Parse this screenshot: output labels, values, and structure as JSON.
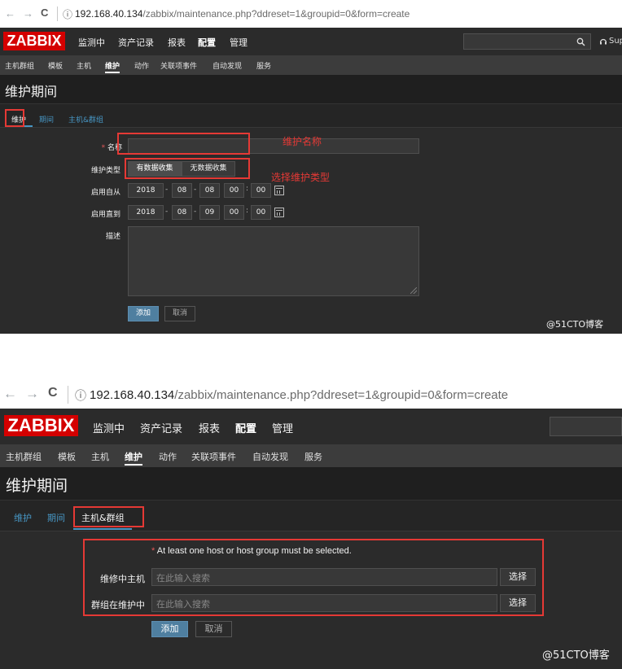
{
  "browser": {
    "url_host": "192.168.40.134",
    "url_path": "/zabbix/maintenance.php?ddreset=1&groupid=0&form=create",
    "nav_back": "←",
    "nav_forward": "→",
    "nav_reload": "C",
    "info_icon": "ⓘ"
  },
  "header": {
    "logo": "ZABBIX",
    "menu": [
      "监测中",
      "资产记录",
      "报表",
      "配置",
      "管理"
    ],
    "active_menu": "配置",
    "search_icon": "🔍",
    "support": "Sup",
    "support_icon": "headset-icon"
  },
  "submenu": [
    "主机群组",
    "模板",
    "主机",
    "维护",
    "动作",
    "关联项事件",
    "自动发现",
    "服务"
  ],
  "active_submenu": "维护",
  "page_title": "维护期间",
  "tabs": [
    "维护",
    "期间",
    "主机&群组"
  ],
  "form1": {
    "required_mark": "*",
    "name_label": "名称",
    "type_label": "维护类型",
    "type_options": [
      "有数据收集",
      "无数据收集"
    ],
    "active_from_label": "启用自从",
    "active_till_label": "启用直到",
    "active_from": {
      "year": "2018",
      "month": "08",
      "day": "08",
      "hour": "00",
      "minute": "00"
    },
    "active_till": {
      "year": "2018",
      "month": "08",
      "day": "09",
      "hour": "00",
      "minute": "00"
    },
    "date_dash": "-",
    "time_colon": ":",
    "description_label": "描述",
    "add_button": "添加",
    "cancel_button": "取消"
  },
  "annotations": {
    "name": "维护名称",
    "type": "选择维护类型"
  },
  "form2": {
    "warning": "At least one host or host group must be selected.",
    "hosts_label": "维修中主机",
    "groups_label": "群组在维护中",
    "placeholder": "在此输入搜索",
    "select_button": "选择",
    "add_button": "添加",
    "cancel_button": "取消"
  },
  "watermark": "@51CTO博客",
  "colors": {
    "brand_red": "#d40000",
    "annotation_red": "#e53935",
    "link_blue": "#4796c4",
    "primary_button": "#4f7fa0",
    "background_dark": "#2b2b2b"
  }
}
